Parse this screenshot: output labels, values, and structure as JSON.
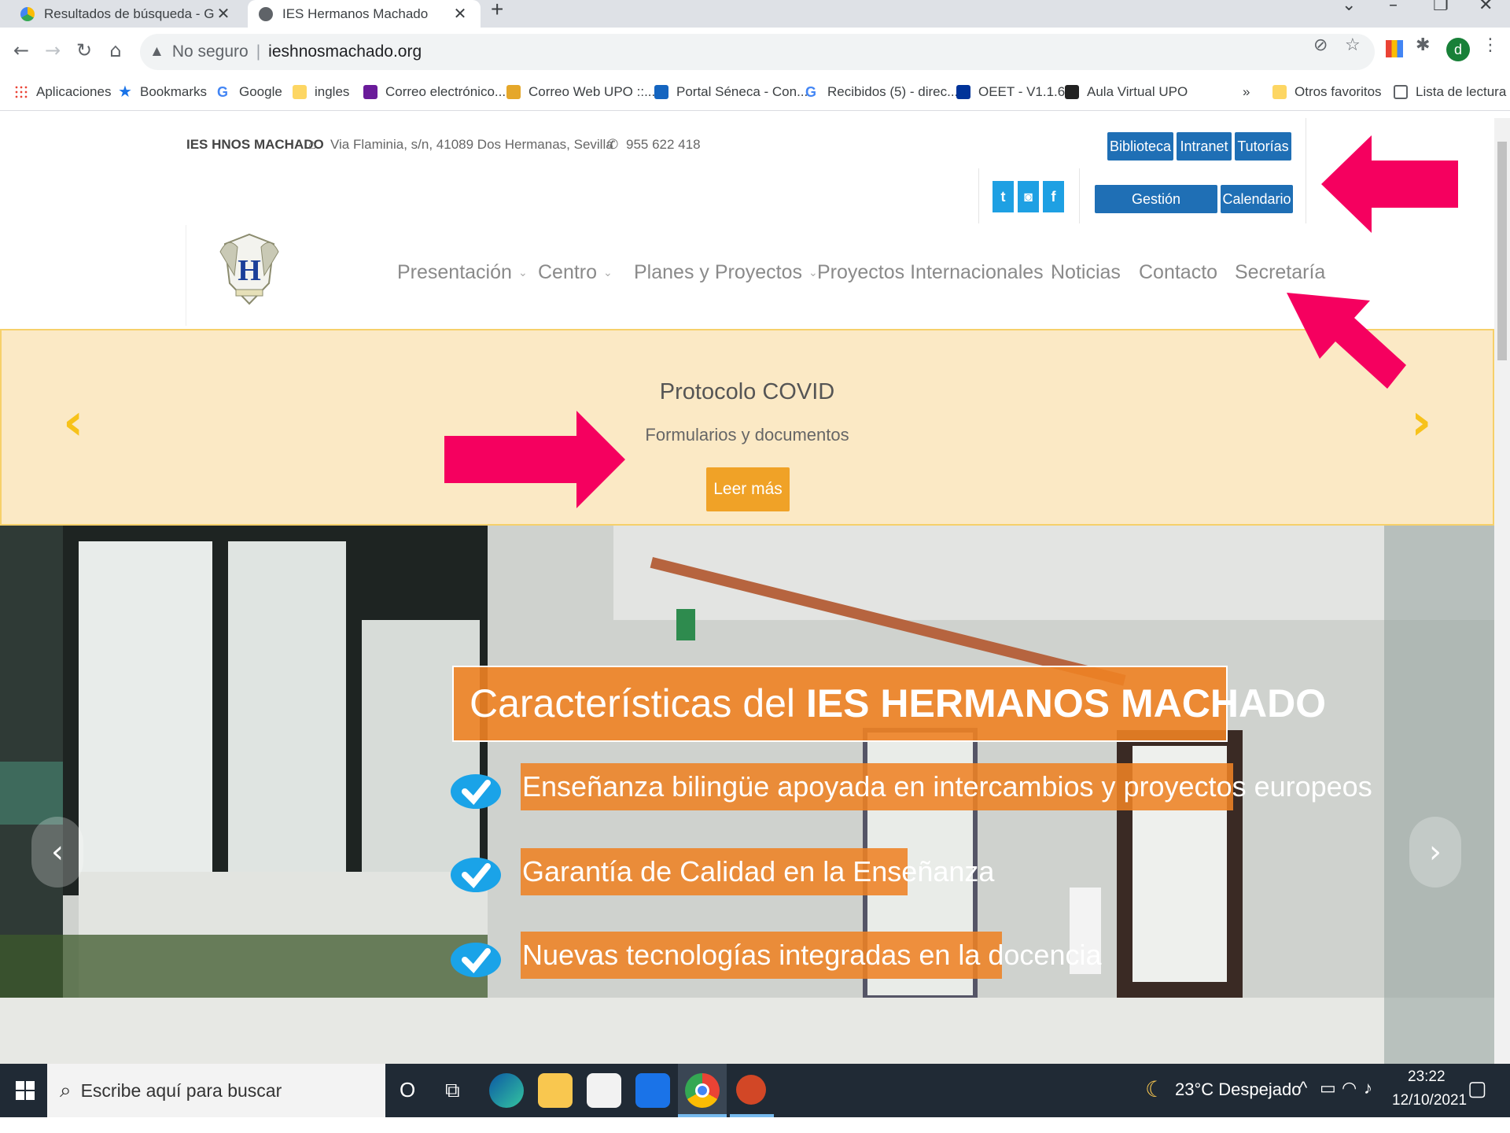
{
  "browser": {
    "tabs": [
      {
        "title": "Resultados de búsqueda - Googl",
        "active": false
      },
      {
        "title": "IES Hermanos Machado",
        "active": true
      }
    ],
    "new_tab": "+",
    "window_controls": [
      "⌄",
      "–",
      "❐",
      "✕"
    ],
    "nav": {
      "back": "←",
      "forward": "→",
      "reload": "↻",
      "home": "⌂"
    },
    "address": {
      "warning_icon": "▲",
      "security_label": "No seguro",
      "separator": "|",
      "url": "ieshnosmachado.org"
    },
    "profile_initial": "d",
    "bookmarks": [
      {
        "label": "Aplicaciones",
        "icon": "apps-grid-icon",
        "color": "#ea4335"
      },
      {
        "label": "Bookmarks",
        "icon": "star-icon",
        "color": "#1a73e8"
      },
      {
        "label": "Google",
        "icon": "google-icon",
        "color": "#4285f4"
      },
      {
        "label": "ingles",
        "icon": "folder-icon",
        "color": "#fdd663"
      },
      {
        "label": "Correo electrónico...",
        "icon": "mail-icon",
        "color": "#6a1b9a"
      },
      {
        "label": "Correo Web UPO ::...",
        "icon": "upo-icon",
        "color": "#e5a72a"
      },
      {
        "label": "Portal Séneca - Con...",
        "icon": "seneca-icon",
        "color": "#1565c0"
      },
      {
        "label": "Recibidos (5) - direc...",
        "icon": "google-icon",
        "color": "#4285f4"
      },
      {
        "label": "OEET - V1.1.6",
        "icon": "eu-flag-icon",
        "color": "#003399"
      },
      {
        "label": "Aula Virtual UPO",
        "icon": "blackboard-icon",
        "color": "#222222"
      }
    ],
    "bookmarks_more": "»",
    "other_favorites": "Otros favoritos",
    "reading_list": "Lista de lectura"
  },
  "site": {
    "school_name": "IES HNOS MACHADO",
    "address": "Via Flaminia, s/n, 41089 Dos Hermanas, Sevilla",
    "phone": "955 622 418",
    "top_buttons": [
      "Biblioteca",
      "Intranet",
      "Tutorías"
    ],
    "second_buttons": [
      "Gestión documental",
      "Calendario"
    ],
    "social": [
      "t",
      "◙",
      "f"
    ],
    "menu": [
      {
        "label": "Presentación",
        "dropdown": true
      },
      {
        "label": "Centro",
        "dropdown": true
      },
      {
        "label": "Planes y Proyectos",
        "dropdown": true
      },
      {
        "label": "Proyectos Internacionales",
        "dropdown": true
      },
      {
        "label": "Noticias",
        "dropdown": false
      },
      {
        "label": "Contacto",
        "dropdown": false
      },
      {
        "label": "Secretaría",
        "dropdown": false
      }
    ],
    "chevron": "⌄",
    "banner": {
      "title": "Protocolo COVID",
      "subtitle": "Formularios y documentos",
      "button": "Leer más",
      "prev": "‹",
      "next": "›"
    },
    "hero": {
      "title_prefix": "Características del ",
      "title_bold": "IES HERMANOS MACHADO",
      "items": [
        "Enseñanza bilingüe apoyada en intercambios y proyectos europeos",
        "Garantía de Calidad en la Enseñanza",
        "Nuevas tecnologías integradas en la docencia"
      ],
      "prev": "‹",
      "next": "›"
    },
    "colors": {
      "accent_blue": "#1f6fb5",
      "banner_orange": "#f0a227",
      "annotation_pink": "#f5005f"
    }
  },
  "taskbar": {
    "search_placeholder": "Escribe aquí para buscar",
    "cortana": "O",
    "weather": "23°C  Despejado",
    "time": "23:22",
    "date": "12/10/2021"
  }
}
